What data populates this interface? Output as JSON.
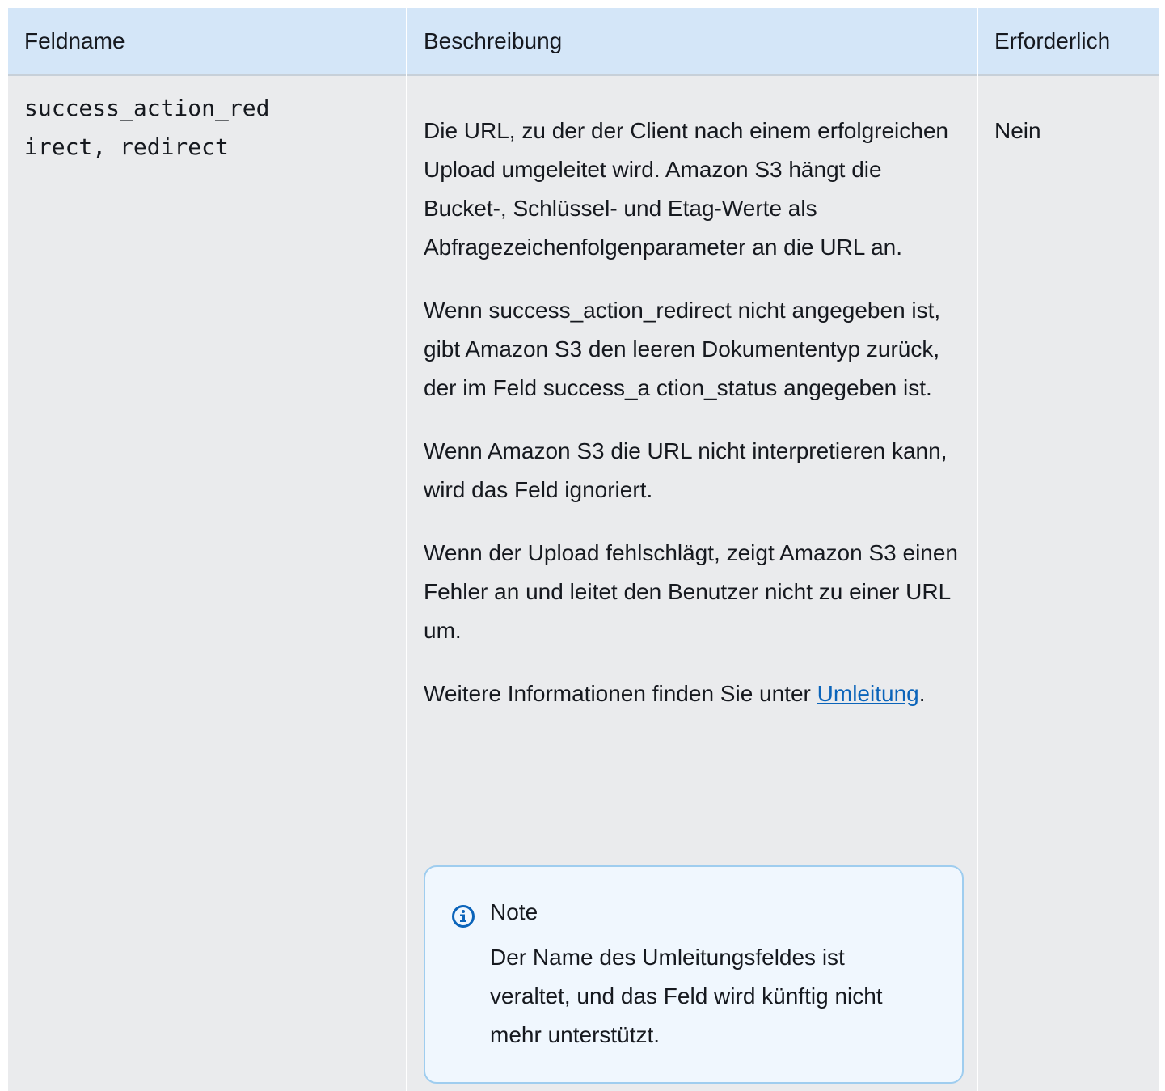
{
  "table": {
    "headers": {
      "field_name": "Feldname",
      "description": "Beschreibung",
      "required": "Erforderlich"
    },
    "row": {
      "field_name_line1": "success_action_red",
      "field_name_line2": "irect, redirect",
      "description": {
        "p1": "Die URL, zu der der Client nach einem erfolgreichen Upload umgeleitet wird. Amazon S3 hängt die Bucket-, Schlüssel- und Etag-Werte als Abfragezeichenfolgenparameter an die URL an.",
        "p2": "Wenn success_action_redirect nicht angegeben ist, gibt Amazon S3 den leeren Dokumententyp zurück, der im Feld success_a ction_status angegeben ist.",
        "p3": "Wenn Amazon S3 die URL nicht interpretieren kann, wird das Feld ignoriert.",
        "p4": "Wenn der Upload fehlschlägt, zeigt Amazon S3 einen Fehler an und leitet den Benutzer nicht zu einer URL um.",
        "p5_prefix": "Weitere Informationen finden Sie unter ",
        "p5_link": "Umleitung",
        "p5_suffix": "."
      },
      "required": "Nein"
    },
    "note": {
      "icon": "info-icon",
      "title": "Note",
      "text": "Der Name des Umleitungsfeldes ist veraltet, und das Feld wird künftig nicht mehr unterstützt."
    }
  },
  "colors": {
    "header_bg": "#d4e6f8",
    "body_bg": "#eaebed",
    "note_bg": "#f0f7fe",
    "note_border": "#9fcdef",
    "link": "#0b64ba",
    "icon": "#0b64ba"
  }
}
